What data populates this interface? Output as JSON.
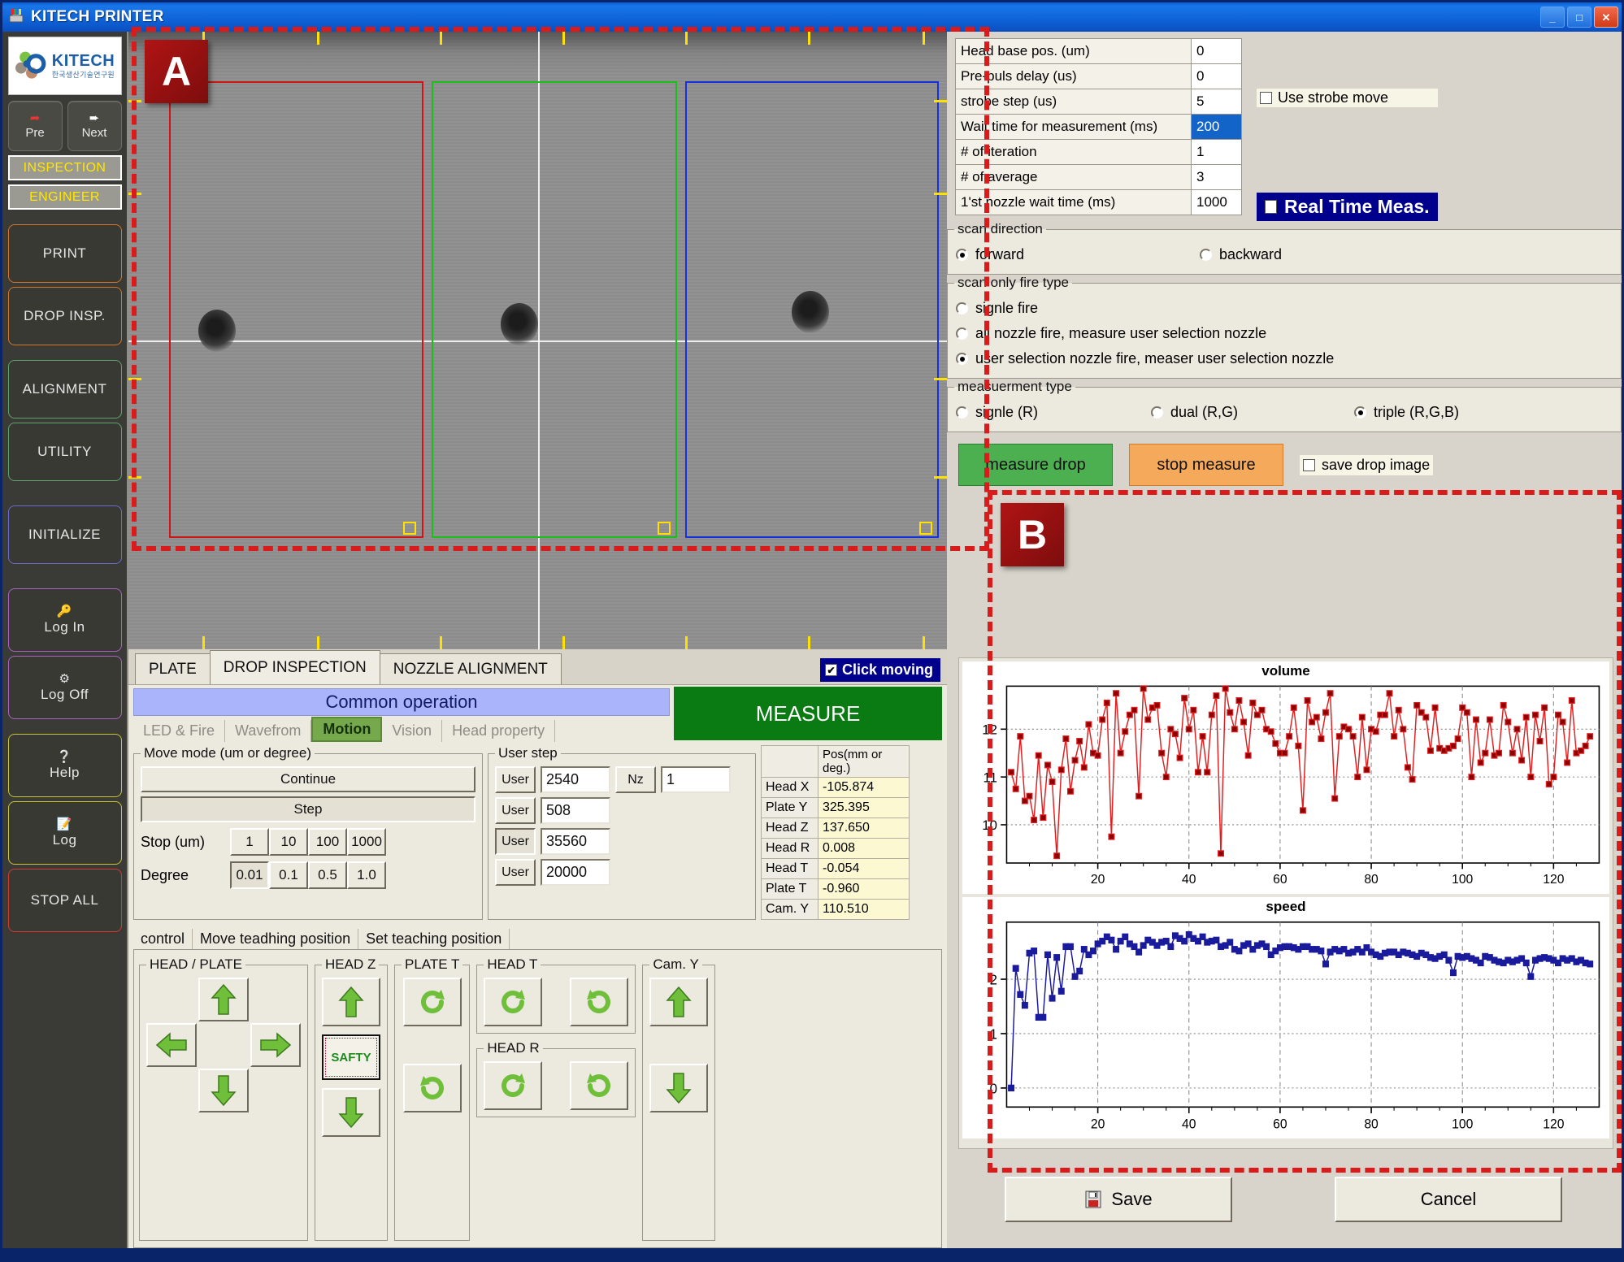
{
  "window": {
    "title": "KITECH PRINTER",
    "icon": "printer-icon",
    "minimize_label": "_",
    "maximize_label": "□",
    "close_label": "✕"
  },
  "sidebar": {
    "logo": {
      "name": "KITECH",
      "subtitle": "한국생산기술연구원"
    },
    "nav": [
      {
        "label": "Pre",
        "icon": "arrow-left-icon"
      },
      {
        "label": "Next",
        "icon": "arrow-right-icon"
      }
    ],
    "modes": [
      {
        "label": "INSPECTION"
      },
      {
        "label": "ENGINEER"
      }
    ],
    "items": [
      {
        "label": "PRINT",
        "accent": "#d2762c"
      },
      {
        "label": "DROP INSP.",
        "accent": "#d2762c"
      },
      {
        "label": "ALIGNMENT",
        "accent": "#5ea36a"
      },
      {
        "label": "UTILITY",
        "accent": "#5ea36a"
      },
      {
        "label": "INITIALIZE",
        "accent": "#6a6ad0"
      },
      {
        "label": "Log In",
        "accent": "#a764c0",
        "icon": "key-icon"
      },
      {
        "label": "Log Off",
        "accent": "#a764c0",
        "icon": "power-icon"
      },
      {
        "label": "Help",
        "accent": "#c7c43a",
        "icon": "question-icon"
      },
      {
        "label": "Log",
        "accent": "#c7c43a",
        "icon": "note-icon"
      },
      {
        "label": "STOP ALL",
        "accent": "#d23b30"
      }
    ]
  },
  "annotations": [
    {
      "label": "A",
      "target": "camera-view"
    },
    {
      "label": "B",
      "target": "charts-panel"
    }
  ],
  "camera": {
    "rois": [
      {
        "color": "#d01515",
        "name": "roi-red"
      },
      {
        "color": "#18c018",
        "name": "roi-green"
      },
      {
        "color": "#1530e0",
        "name": "roi-blue"
      }
    ],
    "crosshair_color": "#ffffff",
    "tick_color": "#ffe000"
  },
  "view_tabs": {
    "tabs": [
      {
        "label": "PLATE",
        "selected": false
      },
      {
        "label": "DROP INSPECTION",
        "selected": true
      },
      {
        "label": "NOZZLE ALIGNMENT",
        "selected": false
      }
    ],
    "click_moving": {
      "label": "Click moving",
      "checked": true,
      "mark": "✔"
    }
  },
  "common_operation": {
    "header": "Common operation",
    "measure_button": "MEASURE",
    "tabs": [
      {
        "label": "LED & Fire",
        "selected": false
      },
      {
        "label": "Wavefrom",
        "selected": false
      },
      {
        "label": "Motion",
        "selected": true
      },
      {
        "label": "Vision",
        "selected": false
      },
      {
        "label": "Head property",
        "selected": false
      }
    ],
    "move_mode": {
      "legend": "Move mode (um or degree)",
      "continue_label": "Continue",
      "step_label": "Step",
      "stop_label": "Stop (um)",
      "stop_values": [
        "1",
        "10",
        "100",
        "1000"
      ],
      "degree_label": "Degree",
      "degree_values": [
        "0.01",
        "0.1",
        "0.5",
        "1.0"
      ],
      "degree_selected": "0.01"
    },
    "user_step": {
      "legend": "User step",
      "rows": [
        {
          "button": "User",
          "value": "2540"
        },
        {
          "button": "User",
          "value": "508"
        },
        {
          "button": "User",
          "value": "35560"
        },
        {
          "button": "User",
          "value": "20000"
        }
      ],
      "nz_button": "Nz",
      "nz_value": "1",
      "selected_row_index": 2
    },
    "position_table": {
      "header_blank": "",
      "header_pos": "Pos(mm or deg.)",
      "rows": [
        {
          "key": "Head X",
          "value": "-105.874"
        },
        {
          "key": "Plate Y",
          "value": "325.395"
        },
        {
          "key": "Head Z",
          "value": "137.650"
        },
        {
          "key": "Head R",
          "value": "0.008"
        },
        {
          "key": "Head T",
          "value": "-0.054"
        },
        {
          "key": "Plate T",
          "value": "-0.960"
        },
        {
          "key": "Cam. Y",
          "value": "110.510"
        }
      ]
    },
    "control_tabs": [
      {
        "label": "control",
        "selected": true
      },
      {
        "label": "Move teadhing position",
        "selected": false
      },
      {
        "label": "Set teaching position",
        "selected": false
      }
    ],
    "control_groups": [
      {
        "legend": "HEAD / PLATE",
        "type": "dpad"
      },
      {
        "legend": "HEAD Z",
        "type": "updown_safety",
        "safety_label": "SAFTY"
      },
      {
        "legend": "PLATE T",
        "type": "rotate_pair"
      },
      {
        "legend": "HEAD T",
        "type": "rotate_lr"
      },
      {
        "legend": "HEAD R",
        "type": "rotate_lr"
      },
      {
        "legend": "Cam.  Y",
        "type": "updown"
      }
    ]
  },
  "parameters": {
    "rows": [
      {
        "label": "Head base pos. (um)",
        "value": "0",
        "selected": false
      },
      {
        "label": "Pre-puls delay (us)",
        "value": "0",
        "selected": false
      },
      {
        "label": "strobe step (us)",
        "value": "5",
        "selected": false
      },
      {
        "label": "Wait time for measurement (ms)",
        "value": "200",
        "selected": true
      },
      {
        "label": "# of iteration",
        "value": "1",
        "selected": false
      },
      {
        "label": "# of average",
        "value": "3",
        "selected": false
      },
      {
        "label": "1'st nozzle wait time (ms)",
        "value": "1000",
        "selected": false
      }
    ],
    "use_strobe_move": {
      "label": "Use strobe move",
      "checked": false
    },
    "real_time_meas": {
      "label": "Real Time Meas.",
      "checked": false
    }
  },
  "scan_direction": {
    "legend": "scan direction",
    "options": [
      {
        "label": "forward",
        "selected": true
      },
      {
        "label": "backward",
        "selected": false
      }
    ]
  },
  "fire_type": {
    "legend": "scan only fire type",
    "options": [
      {
        "label": "signle fire",
        "selected": false
      },
      {
        "label": "all nozzle fire, measure user selection nozzle",
        "selected": false
      },
      {
        "label": "user selection nozzle fire, measer user selection nozzle",
        "selected": true
      }
    ]
  },
  "measurement_type": {
    "legend": "measuerment type",
    "options": [
      {
        "label": "signle (R)",
        "selected": false
      },
      {
        "label": "dual (R,G)",
        "selected": false
      },
      {
        "label": "triple (R,G,B)",
        "selected": true
      }
    ]
  },
  "actions": {
    "measure_drop": "measure drop",
    "stop_measure": "stop measure",
    "save_drop_image": {
      "label": "save drop image",
      "checked": false
    }
  },
  "footer": {
    "save": "Save",
    "save_icon": "save-disk-icon",
    "cancel": "Cancel"
  },
  "colors": {
    "accent_blue": "#0a246a",
    "measure_green": "#0a7a12",
    "measure_drop_green": "#4caf50",
    "stop_orange": "#f5a95b",
    "annotation_red": "#d91b1b",
    "volume_series": "#e02020",
    "speed_series": "#1a1a9c"
  },
  "chart_data": [
    {
      "type": "line",
      "title": "volume",
      "xlabel": "",
      "ylabel": "",
      "xlim": [
        0,
        130
      ],
      "ylim": [
        9.2,
        12.9
      ],
      "xticks": [
        20,
        40,
        60,
        80,
        100,
        120
      ],
      "yticks": [
        10,
        11,
        12
      ],
      "grid": true,
      "legend": "none",
      "marker": "square",
      "color": "#e02020",
      "x": [
        1,
        2,
        3,
        4,
        5,
        6,
        7,
        8,
        9,
        10,
        11,
        12,
        13,
        14,
        15,
        16,
        17,
        18,
        19,
        20,
        21,
        22,
        23,
        24,
        25,
        26,
        27,
        28,
        29,
        30,
        31,
        32,
        33,
        34,
        35,
        36,
        37,
        38,
        39,
        40,
        41,
        42,
        43,
        44,
        45,
        46,
        47,
        48,
        49,
        50,
        51,
        52,
        53,
        54,
        55,
        56,
        57,
        58,
        59,
        60,
        61,
        62,
        63,
        64,
        65,
        66,
        67,
        68,
        69,
        70,
        71,
        72,
        73,
        74,
        75,
        76,
        77,
        78,
        79,
        80,
        81,
        82,
        83,
        84,
        85,
        86,
        87,
        88,
        89,
        90,
        91,
        92,
        93,
        94,
        95,
        96,
        97,
        98,
        99,
        100,
        101,
        102,
        103,
        104,
        105,
        106,
        107,
        108,
        109,
        110,
        111,
        112,
        113,
        114,
        115,
        116,
        117,
        118,
        119,
        120,
        121,
        122,
        123,
        124,
        125,
        126,
        127,
        128
      ],
      "values": [
        11.1,
        10.75,
        11.85,
        10.5,
        10.6,
        10.1,
        11.45,
        10.15,
        11.25,
        10.9,
        9.35,
        11.15,
        11.8,
        10.7,
        11.35,
        11.75,
        11.2,
        12.1,
        11.5,
        11.45,
        12.2,
        12.55,
        9.75,
        12.75,
        11.5,
        11.95,
        12.3,
        12.4,
        10.6,
        12.85,
        12.2,
        12.45,
        12.5,
        11.5,
        11.0,
        12.0,
        11.9,
        11.4,
        12.65,
        12.0,
        12.4,
        11.1,
        11.85,
        11.1,
        12.3,
        12.7,
        9.4,
        12.85,
        12.35,
        12.0,
        12.6,
        12.15,
        11.45,
        12.55,
        12.3,
        12.4,
        12.0,
        11.95,
        11.7,
        11.5,
        11.5,
        11.85,
        12.45,
        11.65,
        10.3,
        12.6,
        12.15,
        12.25,
        11.8,
        12.35,
        12.75,
        10.55,
        11.85,
        12.05,
        12.0,
        11.85,
        11.0,
        12.25,
        11.15,
        12.0,
        11.95,
        12.3,
        12.3,
        12.75,
        11.85,
        12.4,
        12.0,
        11.2,
        10.95,
        12.5,
        12.35,
        12.25,
        11.55,
        12.45,
        11.6,
        11.55,
        11.6,
        11.65,
        11.8,
        12.45,
        12.35,
        11.0,
        12.2,
        11.3,
        11.5,
        12.2,
        11.45,
        11.5,
        12.5,
        12.15,
        11.5,
        12.0,
        11.35,
        12.25,
        11.0,
        12.3,
        11.75,
        12.45,
        10.85,
        11.0,
        12.3,
        12.15,
        11.3,
        12.6,
        11.5,
        11.55,
        11.65,
        11.85
      ]
    },
    {
      "type": "line",
      "title": "speed",
      "xlabel": "",
      "ylabel": "",
      "xlim": [
        0,
        130
      ],
      "ylim": [
        -0.35,
        3.05
      ],
      "xticks": [
        20,
        40,
        60,
        80,
        100,
        120
      ],
      "yticks": [
        0,
        1,
        2
      ],
      "grid": true,
      "legend": "none",
      "marker": "square",
      "color": "#1a1a9c",
      "x": [
        1,
        2,
        3,
        4,
        5,
        6,
        7,
        8,
        9,
        10,
        11,
        12,
        13,
        14,
        15,
        16,
        17,
        18,
        19,
        20,
        21,
        22,
        23,
        24,
        25,
        26,
        27,
        28,
        29,
        30,
        31,
        32,
        33,
        34,
        35,
        36,
        37,
        38,
        39,
        40,
        41,
        42,
        43,
        44,
        45,
        46,
        47,
        48,
        49,
        50,
        51,
        52,
        53,
        54,
        55,
        56,
        57,
        58,
        59,
        60,
        61,
        62,
        63,
        64,
        65,
        66,
        67,
        68,
        69,
        70,
        71,
        72,
        73,
        74,
        75,
        76,
        77,
        78,
        79,
        80,
        81,
        82,
        83,
        84,
        85,
        86,
        87,
        88,
        89,
        90,
        91,
        92,
        93,
        94,
        95,
        96,
        97,
        98,
        99,
        100,
        101,
        102,
        103,
        104,
        105,
        106,
        107,
        108,
        109,
        110,
        111,
        112,
        113,
        114,
        115,
        116,
        117,
        118,
        119,
        120,
        121,
        122,
        123,
        124,
        125,
        126,
        127,
        128
      ],
      "values": [
        0.0,
        2.2,
        1.72,
        1.52,
        2.48,
        2.52,
        1.3,
        1.3,
        2.45,
        1.65,
        2.4,
        1.78,
        2.6,
        2.6,
        2.05,
        2.15,
        2.55,
        2.45,
        2.52,
        2.65,
        2.7,
        2.78,
        2.72,
        2.55,
        2.7,
        2.78,
        2.65,
        2.6,
        2.5,
        2.62,
        2.72,
        2.68,
        2.62,
        2.68,
        2.7,
        2.6,
        2.8,
        2.75,
        2.7,
        2.82,
        2.75,
        2.7,
        2.78,
        2.68,
        2.7,
        2.72,
        2.6,
        2.62,
        2.68,
        2.55,
        2.52,
        2.62,
        2.65,
        2.55,
        2.62,
        2.65,
        2.6,
        2.45,
        2.52,
        2.58,
        2.6,
        2.6,
        2.58,
        2.55,
        2.6,
        2.6,
        2.55,
        2.55,
        2.52,
        2.28,
        2.5,
        2.55,
        2.52,
        2.55,
        2.48,
        2.5,
        2.55,
        2.5,
        2.58,
        2.5,
        2.45,
        2.42,
        2.48,
        2.5,
        2.5,
        2.45,
        2.5,
        2.48,
        2.45,
        2.42,
        2.48,
        2.45,
        2.4,
        2.38,
        2.42,
        2.45,
        2.35,
        2.12,
        2.42,
        2.4,
        2.42,
        2.38,
        2.35,
        2.3,
        2.42,
        2.4,
        2.35,
        2.32,
        2.3,
        2.35,
        2.32,
        2.35,
        2.38,
        2.3,
        2.05,
        2.35,
        2.38,
        2.4,
        2.38,
        2.35,
        2.3,
        2.38,
        2.35,
        2.38,
        2.32,
        2.35,
        2.3,
        2.28
      ]
    }
  ]
}
